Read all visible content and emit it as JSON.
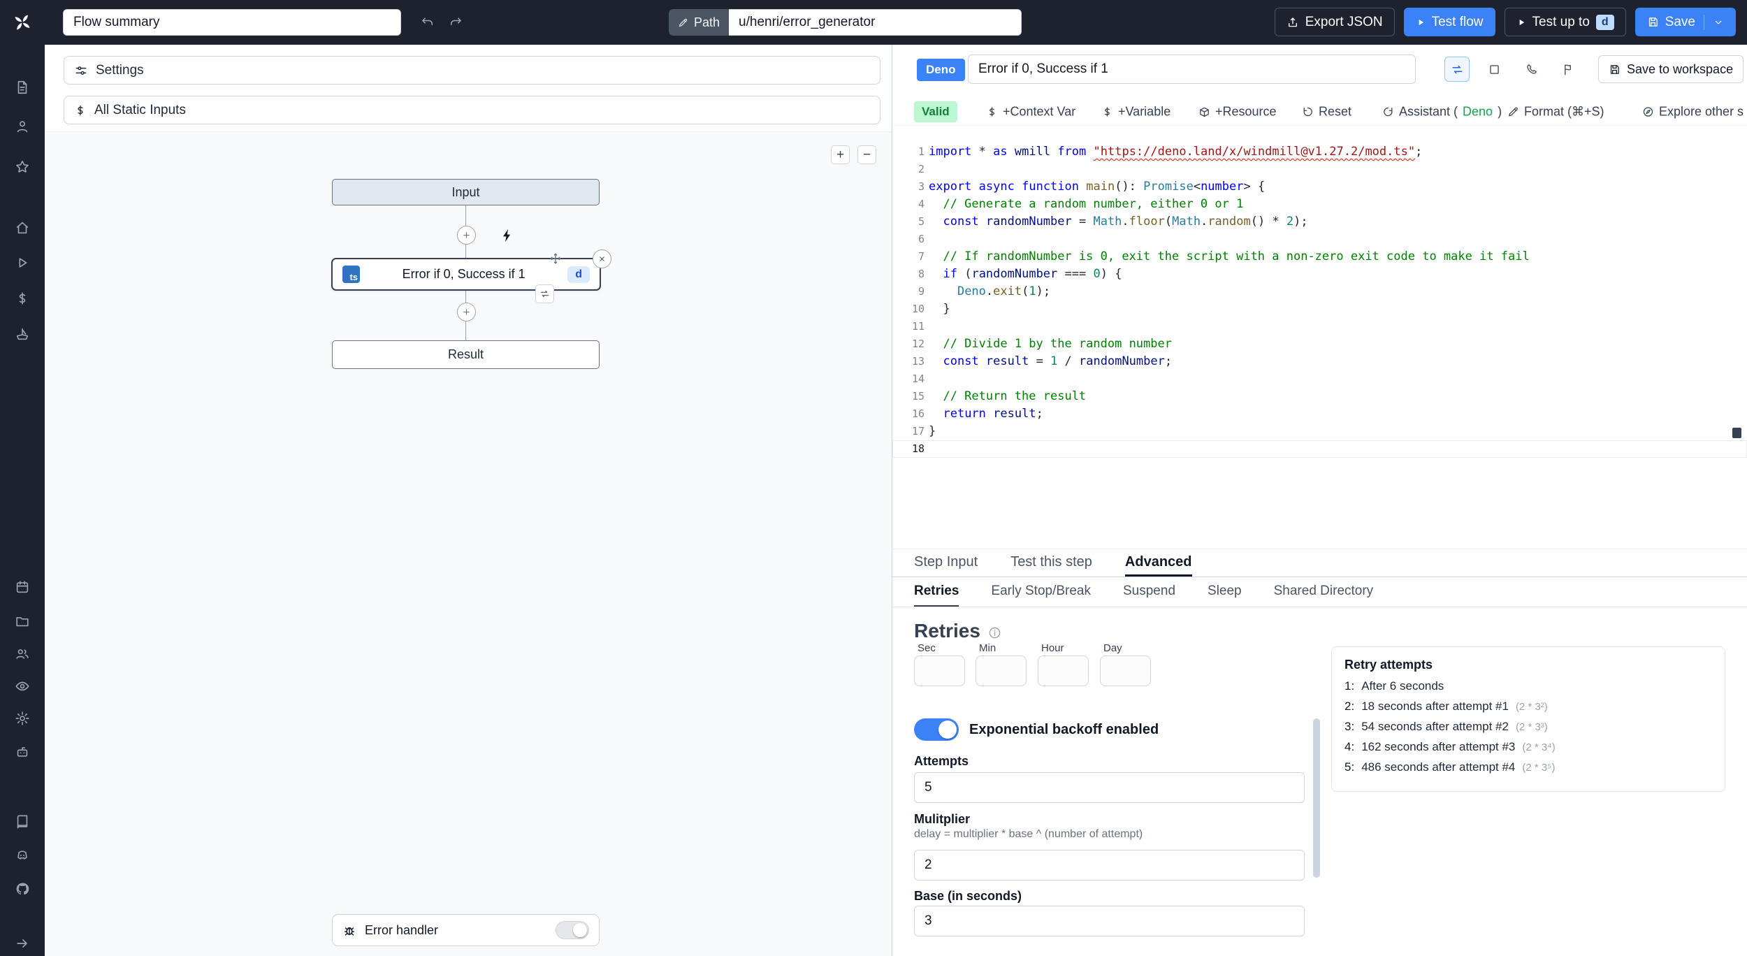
{
  "topbar": {
    "flow_summary_value": "Flow summary",
    "path_label": "Path",
    "path_value": "u/henri/error_generator",
    "export_json_label": "Export JSON",
    "test_flow_label": "Test flow",
    "test_up_to_label": "Test up to",
    "test_up_to_badge": "d",
    "save_label": "Save"
  },
  "sidebar": {
    "icons": [
      "document",
      "user",
      "star",
      "home",
      "play",
      "dollar",
      "ship",
      "calendar",
      "folder",
      "users",
      "eye",
      "gear",
      "bot",
      "book",
      "discord",
      "github"
    ],
    "expand": "arrow-right"
  },
  "left_panel": {
    "settings_label": "Settings",
    "static_inputs_label": "All Static Inputs",
    "zoom_in": "+",
    "zoom_out": "−",
    "input_node": "Input",
    "step_node": {
      "lang": "ts",
      "label": "Error if 0, Success if 1",
      "id_badge": "d"
    },
    "result_node": "Result",
    "error_handler_label": "Error handler"
  },
  "right_panel": {
    "lang_badge": "Deno",
    "step_name": "Error if 0, Success if 1",
    "save_to_workspace_label": "Save to workspace",
    "valid_badge": "Valid",
    "toolbar": [
      {
        "name": "context-var",
        "icon": "dollar",
        "label": "+Context Var"
      },
      {
        "name": "variable",
        "icon": "dollar",
        "label": "+Variable"
      },
      {
        "name": "resource",
        "icon": "package",
        "label": "+Resource"
      },
      {
        "name": "reset",
        "icon": "reset",
        "label": "Reset"
      },
      {
        "name": "assistant",
        "icon": "refresh",
        "prefix": "Assistant (",
        "accent": "Deno",
        "suffix": ")"
      },
      {
        "name": "format",
        "icon": "pencil",
        "label": "Format (⌘+S)"
      },
      {
        "name": "explore",
        "icon": "compass",
        "label": "Explore other s"
      }
    ],
    "tabs": [
      {
        "label": "Step Input"
      },
      {
        "label": "Test this step"
      },
      {
        "label": "Advanced",
        "active": true
      }
    ],
    "subtabs": [
      {
        "label": "Retries",
        "active": true
      },
      {
        "label": "Early Stop/Break"
      },
      {
        "label": "Suspend"
      },
      {
        "label": "Sleep"
      },
      {
        "label": "Shared Directory"
      }
    ]
  },
  "editor": {
    "lines": [
      [
        [
          "k",
          "import"
        ],
        [
          "d",
          " * "
        ],
        [
          "k",
          "as"
        ],
        [
          "d",
          " "
        ],
        [
          "v",
          "wmill"
        ],
        [
          "d",
          " "
        ],
        [
          "k",
          "from"
        ],
        [
          "d",
          " "
        ],
        [
          "se",
          "\"https://deno.land/x/windmill@v1.27.2/mod.ts\""
        ],
        [
          "d",
          ";"
        ]
      ],
      [],
      [
        [
          "k",
          "export"
        ],
        [
          "d",
          " "
        ],
        [
          "k",
          "async"
        ],
        [
          "d",
          " "
        ],
        [
          "k",
          "function"
        ],
        [
          "d",
          " "
        ],
        [
          "f",
          "main"
        ],
        [
          "d",
          "(): "
        ],
        [
          "t",
          "Promise"
        ],
        [
          "d",
          "<"
        ],
        [
          "k",
          "number"
        ],
        [
          "d",
          "> {"
        ]
      ],
      [
        [
          "c",
          "  // Generate a random number, either 0 or 1"
        ]
      ],
      [
        [
          "d",
          "  "
        ],
        [
          "k",
          "const"
        ],
        [
          "d",
          " "
        ],
        [
          "v",
          "randomNumber"
        ],
        [
          "d",
          " = "
        ],
        [
          "t",
          "Math"
        ],
        [
          "d",
          "."
        ],
        [
          "f",
          "floor"
        ],
        [
          "d",
          "("
        ],
        [
          "t",
          "Math"
        ],
        [
          "d",
          "."
        ],
        [
          "f",
          "random"
        ],
        [
          "d",
          "() * "
        ],
        [
          "n",
          "2"
        ],
        [
          "d",
          ");"
        ]
      ],
      [],
      [
        [
          "c",
          "  // If randomNumber is 0, exit the script with a non-zero exit code to make it fail"
        ]
      ],
      [
        [
          "d",
          "  "
        ],
        [
          "k",
          "if"
        ],
        [
          "d",
          " ("
        ],
        [
          "v",
          "randomNumber"
        ],
        [
          "d",
          " === "
        ],
        [
          "n",
          "0"
        ],
        [
          "d",
          ") {"
        ]
      ],
      [
        [
          "d",
          "    "
        ],
        [
          "t",
          "Deno"
        ],
        [
          "d",
          "."
        ],
        [
          "f",
          "exit"
        ],
        [
          "d",
          "("
        ],
        [
          "n",
          "1"
        ],
        [
          "d",
          ");"
        ]
      ],
      [
        [
          "d",
          "  }"
        ]
      ],
      [],
      [
        [
          "c",
          "  // Divide 1 by the random number"
        ]
      ],
      [
        [
          "d",
          "  "
        ],
        [
          "k",
          "const"
        ],
        [
          "d",
          " "
        ],
        [
          "v",
          "result"
        ],
        [
          "d",
          " = "
        ],
        [
          "n",
          "1"
        ],
        [
          "d",
          " / "
        ],
        [
          "v",
          "randomNumber"
        ],
        [
          "d",
          ";"
        ]
      ],
      [],
      [
        [
          "c",
          "  // Return the result"
        ]
      ],
      [
        [
          "d",
          "  "
        ],
        [
          "k",
          "return"
        ],
        [
          "d",
          " "
        ],
        [
          "v",
          "result"
        ],
        [
          "d",
          ";"
        ]
      ],
      [
        [
          "d",
          "}"
        ]
      ],
      []
    ]
  },
  "retries": {
    "heading": "Retries",
    "time_units": [
      "Sec",
      "Min",
      "Hour",
      "Day"
    ],
    "backoff_toggle_label": "Exponential backoff enabled",
    "attempts_label": "Attempts",
    "attempts_value": "5",
    "multiplier_label": "Mulitplier",
    "multiplier_help": "delay = multiplier * base ^ (number of attempt)",
    "multiplier_value": "2",
    "base_label": "Base (in seconds)",
    "base_value": "3",
    "retry_box_title": "Retry attempts",
    "retry_attempts": [
      {
        "n": "1:",
        "text": "After 6 seconds",
        "formula": ""
      },
      {
        "n": "2:",
        "text": "18 seconds after attempt #1",
        "formula": "(2 * 3²)"
      },
      {
        "n": "3:",
        "text": "54 seconds after attempt #2",
        "formula": "(2 * 3³)"
      },
      {
        "n": "4:",
        "text": "162 seconds after attempt #3",
        "formula": "(2 * 3⁴)"
      },
      {
        "n": "5:",
        "text": "486 seconds after attempt #4",
        "formula": "(2 * 3⁵)"
      }
    ]
  }
}
